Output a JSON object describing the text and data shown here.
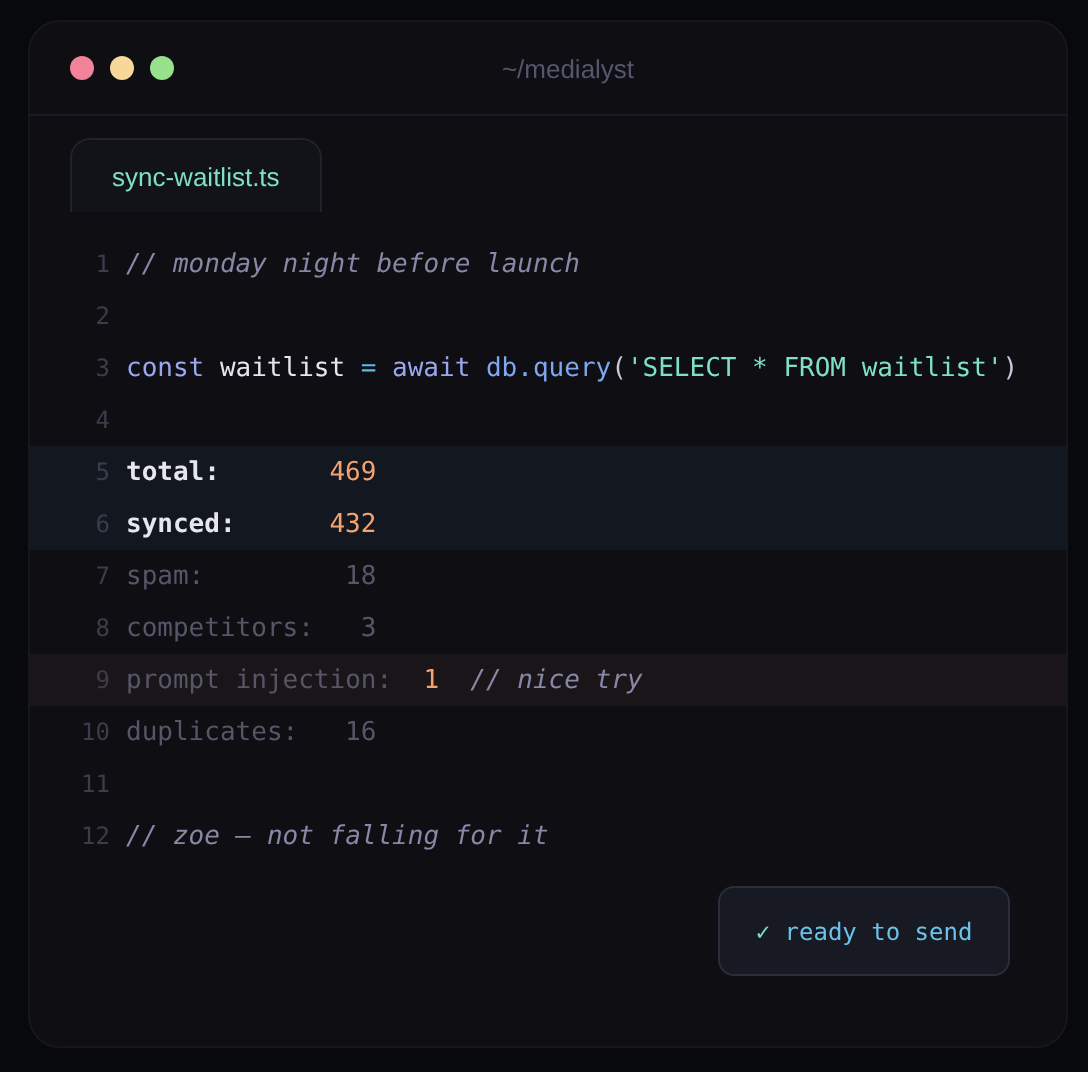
{
  "window": {
    "title": "~/medialyst"
  },
  "tabs": [
    {
      "label": "sync-waitlist.ts",
      "selected": true
    }
  ],
  "lines": [
    {
      "n": "1",
      "kind": "comment",
      "text": "// monday night before launch"
    },
    {
      "n": "2",
      "kind": "blank"
    },
    {
      "n": "3",
      "kind": "code",
      "tokens": [
        {
          "kind": "keyword",
          "text": "const"
        },
        {
          "kind": "ident",
          "text": "waitlist"
        },
        {
          "kind": "op",
          "text": "="
        },
        {
          "kind": "keyword",
          "text": "await"
        },
        {
          "kind": "fn",
          "text": "db.query"
        },
        {
          "kind": "punct",
          "text": "("
        },
        {
          "kind": "str",
          "text": "'SELECT * FROM waitlist'"
        },
        {
          "kind": "punct",
          "text": ")"
        }
      ]
    },
    {
      "n": "4",
      "kind": "blank"
    },
    {
      "n": "5",
      "kind": "stat",
      "label": "total:",
      "value": "469",
      "dim": false,
      "color": "#121720"
    },
    {
      "n": "6",
      "kind": "stat",
      "label": "synced:",
      "value": "432",
      "dim": false,
      "color": "#121720"
    },
    {
      "n": "7",
      "kind": "stat",
      "label": "spam:",
      "value": "18",
      "dim": true
    },
    {
      "n": "8",
      "kind": "stat",
      "label": "competitors:",
      "value": "3",
      "dim": true
    },
    {
      "n": "9",
      "kind": "stat",
      "label": "prompt injection:",
      "value": "1",
      "note": "// nice try",
      "dim": true,
      "color": "#1a1519"
    },
    {
      "n": "10",
      "kind": "stat",
      "label": "duplicates:",
      "value": "16",
      "dim": true
    },
    {
      "n": "11",
      "kind": "blank"
    },
    {
      "n": "12",
      "kind": "comment",
      "text": "// zoe — not falling for it"
    }
  ],
  "status": {
    "check": "✓",
    "label": "ready to send"
  }
}
